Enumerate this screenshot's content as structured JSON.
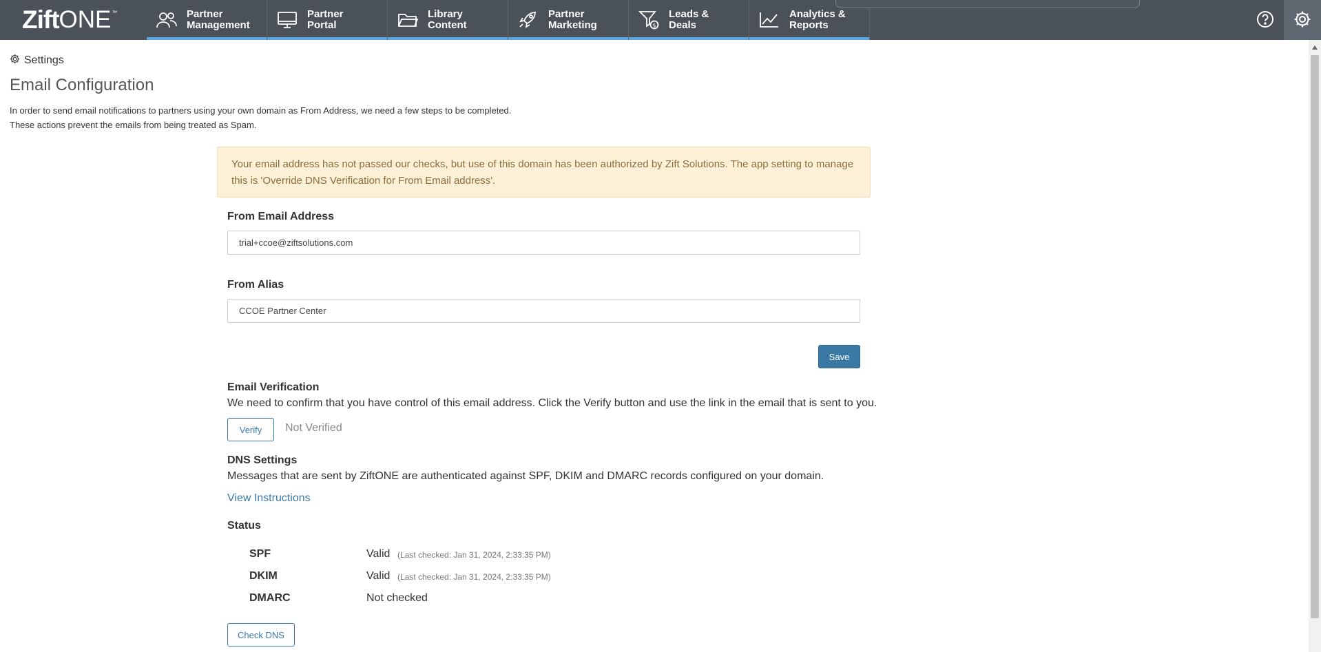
{
  "app": {
    "logo_main": "Zift",
    "logo_suffix": "ONE",
    "logo_tm": "™"
  },
  "nav": {
    "items": [
      {
        "label": "Partner\nManagement",
        "icon": "users-icon"
      },
      {
        "label": "Partner\nPortal",
        "icon": "monitor-icon"
      },
      {
        "label": "Library\nContent",
        "icon": "folder-icon"
      },
      {
        "label": "Partner\nMarketing",
        "icon": "rocket-icon"
      },
      {
        "label": "Leads &\nDeals",
        "icon": "funnel-dollar-icon"
      },
      {
        "label": "Analytics &\nReports",
        "icon": "chart-line-icon"
      }
    ],
    "help_icon": "help-icon",
    "settings_icon": "gear-icon"
  },
  "breadcrumb": {
    "label": "Settings"
  },
  "page": {
    "title": "Email Configuration",
    "intro_line1": "In order to send email notifications to partners using your own domain as From Address, we need a few steps to be completed.",
    "intro_line2": "These actions prevent the emails from being treated as Spam."
  },
  "alert": {
    "text": "Your email address has not passed our checks, but use of this domain has been authorized by Zift Solutions. The app setting to manage this is 'Override DNS Verification for From Email address'."
  },
  "form": {
    "from_email_label": "From Email Address",
    "from_email_value": "trial+ccoe@ziftsolutions.com",
    "from_alias_label": "From Alias",
    "from_alias_value": "CCOE Partner Center",
    "save_label": "Save"
  },
  "verification": {
    "heading": "Email Verification",
    "description": "We need to confirm that you have control of this email address. Click the Verify button and use the link in the email that is sent to you.",
    "verify_label": "Verify",
    "status": "Not Verified"
  },
  "dns": {
    "heading": "DNS Settings",
    "description": "Messages that are sent by ZiftONE are authenticated against SPF, DKIM and DMARC records configured on your domain.",
    "instructions_link": "View Instructions",
    "status_heading": "Status",
    "records": [
      {
        "name": "SPF",
        "value": "Valid",
        "checked": "(Last checked: Jan 31, 2024, 2:33:35 PM)"
      },
      {
        "name": "DKIM",
        "value": "Valid",
        "checked": "(Last checked: Jan 31, 2024, 2:33:35 PM)"
      },
      {
        "name": "DMARC",
        "value": "Not checked",
        "checked": ""
      }
    ],
    "check_label": "Check DNS"
  },
  "colors": {
    "nav_bg": "#4a5159",
    "nav_accent": "#5aa9e6",
    "primary": "#3a79a6",
    "alert_bg": "#fcf0d6",
    "alert_text": "#8a6d3b"
  }
}
